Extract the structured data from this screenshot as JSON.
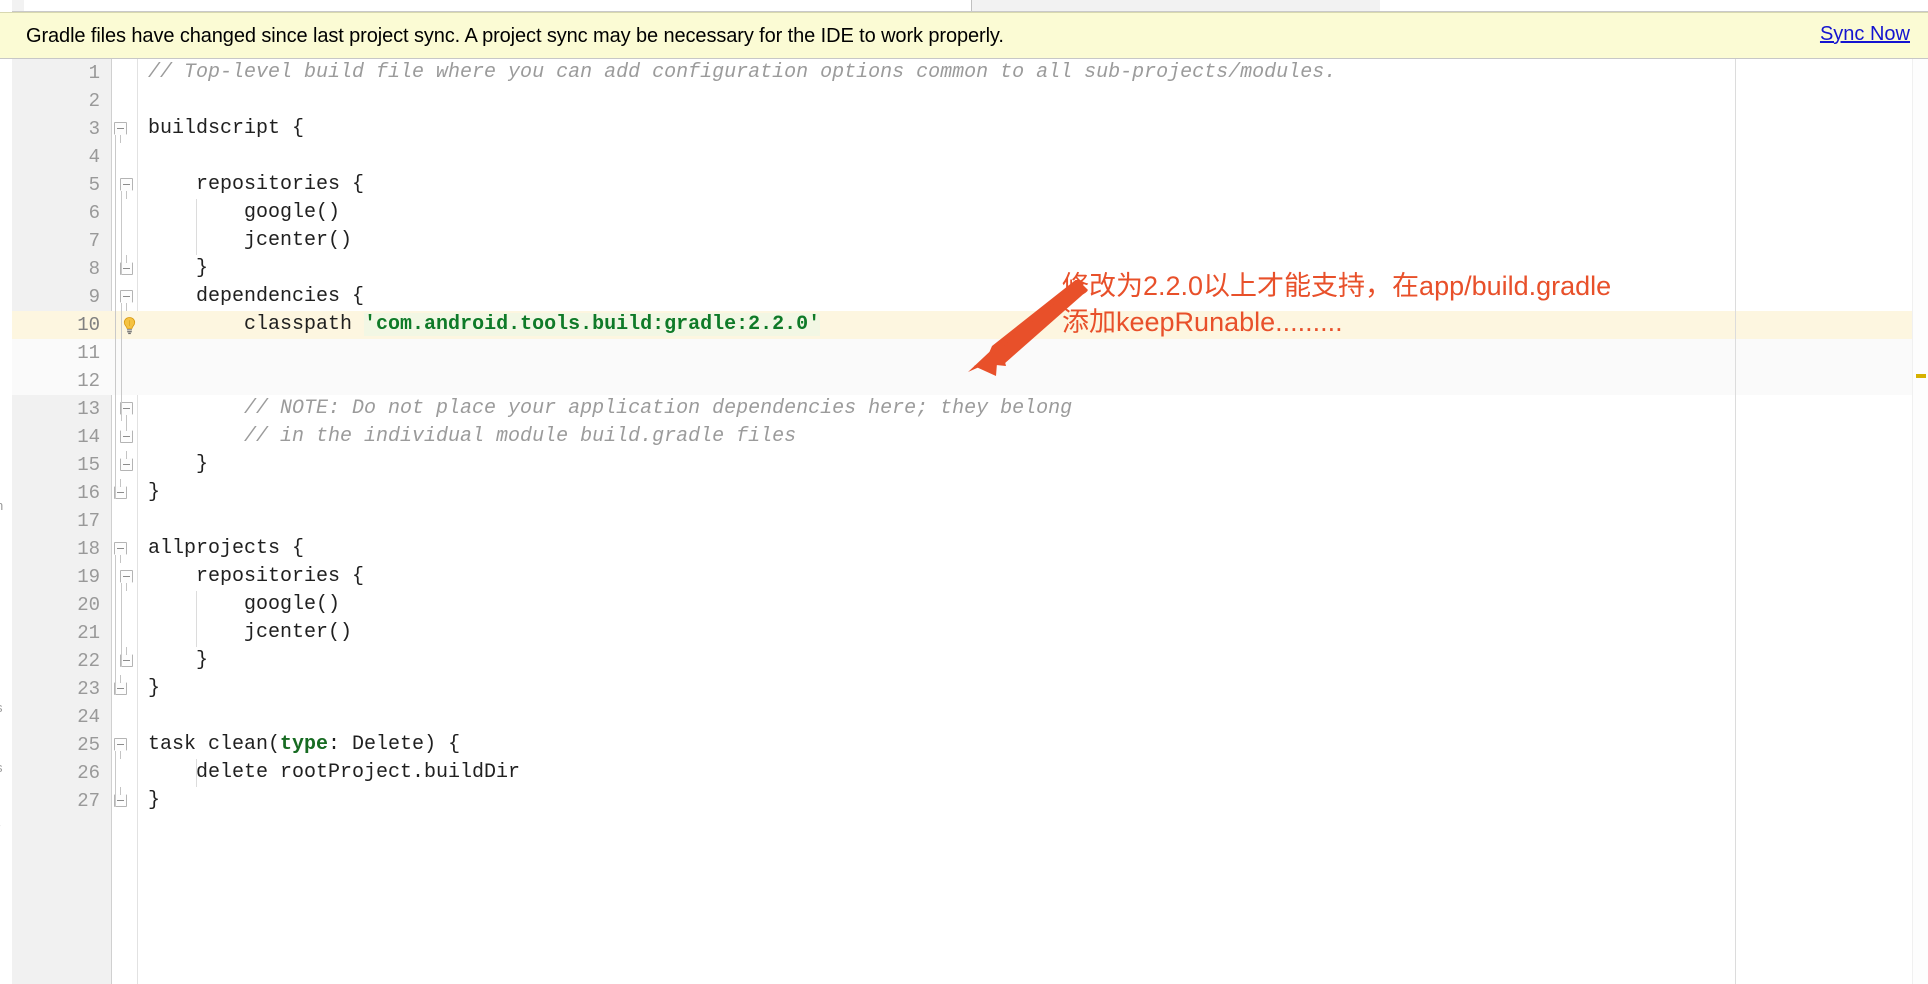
{
  "banner": {
    "message": "Gradle files have changed since last project sync. A project sync may be necessary for the IDE to work properly.",
    "link_label": "Sync Now",
    "background_color": "#fbfbd4",
    "link_color": "#1414d0"
  },
  "editor": {
    "language": "gradle",
    "caret_line": 10,
    "intention_icon": "lightbulb-icon",
    "lines": [
      {
        "n": "1",
        "indent": 0,
        "tokens": [
          {
            "t": "// Top-level build file where you can add configuration options common to all sub-projects/modules.",
            "k": "cmt"
          }
        ]
      },
      {
        "n": "2",
        "indent": 0,
        "tokens": []
      },
      {
        "n": "3",
        "indent": 0,
        "tokens": [
          {
            "t": "buildscript {",
            "k": ""
          }
        ]
      },
      {
        "n": "4",
        "indent": 0,
        "tokens": []
      },
      {
        "n": "5",
        "indent": 1,
        "tokens": [
          {
            "t": "    repositories {",
            "k": ""
          }
        ]
      },
      {
        "n": "6",
        "indent": 2,
        "tokens": [
          {
            "t": "        google()",
            "k": ""
          }
        ]
      },
      {
        "n": "7",
        "indent": 2,
        "tokens": [
          {
            "t": "        jcenter()",
            "k": ""
          }
        ]
      },
      {
        "n": "8",
        "indent": 1,
        "tokens": [
          {
            "t": "    }",
            "k": ""
          }
        ]
      },
      {
        "n": "9",
        "indent": 1,
        "tokens": [
          {
            "t": "    dependencies {",
            "k": ""
          }
        ]
      },
      {
        "n": "10",
        "indent": 2,
        "tokens": [
          {
            "t": "        classpath ",
            "k": ""
          },
          {
            "t": "'com.android.tools.build:gradle:2.2.0'",
            "k": "str"
          }
        ]
      },
      {
        "n": "11",
        "indent": 2,
        "tokens": []
      },
      {
        "n": "12",
        "indent": 2,
        "tokens": []
      },
      {
        "n": "13",
        "indent": 2,
        "tokens": [
          {
            "t": "        // NOTE: Do not place your application dependencies here; they belong",
            "k": "cmt"
          }
        ]
      },
      {
        "n": "14",
        "indent": 2,
        "tokens": [
          {
            "t": "        // in the individual module build.gradle files",
            "k": "cmt"
          }
        ]
      },
      {
        "n": "15",
        "indent": 1,
        "tokens": [
          {
            "t": "    }",
            "k": ""
          }
        ]
      },
      {
        "n": "16",
        "indent": 0,
        "tokens": [
          {
            "t": "}",
            "k": ""
          }
        ]
      },
      {
        "n": "17",
        "indent": 0,
        "tokens": []
      },
      {
        "n": "18",
        "indent": 0,
        "tokens": [
          {
            "t": "allprojects {",
            "k": ""
          }
        ]
      },
      {
        "n": "19",
        "indent": 1,
        "tokens": [
          {
            "t": "    repositories {",
            "k": ""
          }
        ]
      },
      {
        "n": "20",
        "indent": 2,
        "tokens": [
          {
            "t": "        google()",
            "k": ""
          }
        ]
      },
      {
        "n": "21",
        "indent": 2,
        "tokens": [
          {
            "t": "        jcenter()",
            "k": ""
          }
        ]
      },
      {
        "n": "22",
        "indent": 1,
        "tokens": [
          {
            "t": "    }",
            "k": ""
          }
        ]
      },
      {
        "n": "23",
        "indent": 0,
        "tokens": [
          {
            "t": "}",
            "k": ""
          }
        ]
      },
      {
        "n": "24",
        "indent": 0,
        "tokens": []
      },
      {
        "n": "25",
        "indent": 0,
        "tokens": [
          {
            "t": "task clean(",
            "k": ""
          },
          {
            "t": "type",
            "k": "kw"
          },
          {
            "t": ": Delete) {",
            "k": ""
          }
        ]
      },
      {
        "n": "26",
        "indent": 1,
        "tokens": [
          {
            "t": "    delete rootProject.buildDir",
            "k": ""
          }
        ]
      },
      {
        "n": "27",
        "indent": 0,
        "tokens": [
          {
            "t": "}",
            "k": ""
          }
        ]
      }
    ]
  },
  "annotation": {
    "line1": "修改为2.2.0以上才能支持，在app/build.gradle",
    "line2": "添加keepRunable.........",
    "color": "#e8502a",
    "arrow": "arrow-pointing-down-left"
  },
  "left_sliver_fragments": [
    "n",
    ".",
    ".",
    "s",
    "s",
    "r"
  ]
}
